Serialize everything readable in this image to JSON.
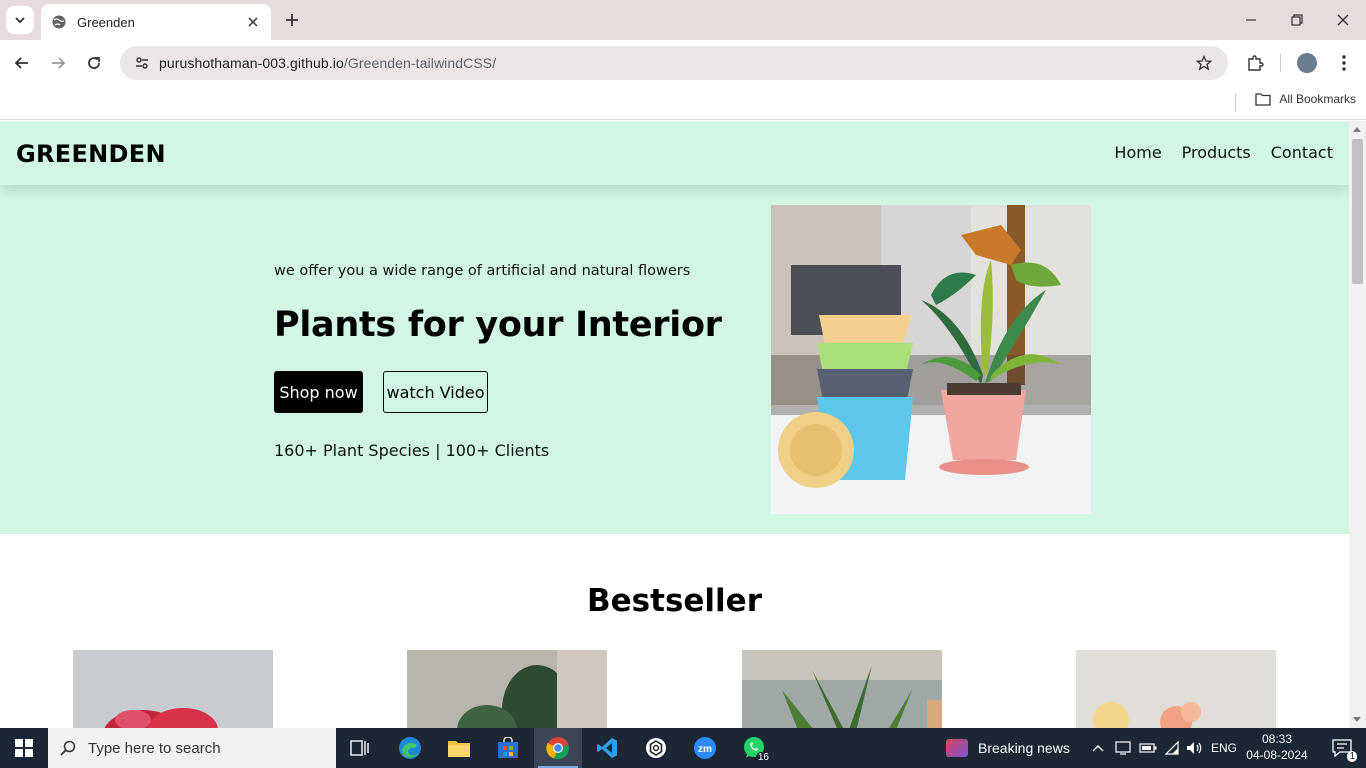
{
  "browser": {
    "tab_title": "Greenden",
    "url_host": "purushothaman-003.github.io",
    "url_path": "/Greenden-tailwindCSS/",
    "bookmarks_label": "All Bookmarks"
  },
  "site": {
    "brand": "GREENDEN",
    "nav": [
      "Home",
      "Products",
      "Contact"
    ],
    "hero": {
      "subtitle": "we offer you a wide range of artificial and natural flowers",
      "title": "Plants for your Interior",
      "primary_button": "Shop now",
      "secondary_button": "watch Video",
      "stats": "160+ Plant Species | 100+ Clients"
    },
    "bestseller_title": "Bestseller",
    "colors": {
      "hero_bg": "#d1f7e4",
      "button_bg": "#000000"
    }
  },
  "taskbar": {
    "search_placeholder": "Type here to search",
    "news_label": "Breaking news",
    "whatsapp_badge": "16",
    "language": "ENG",
    "time": "08:33",
    "date": "04-08-2024",
    "notification_count": "1"
  }
}
